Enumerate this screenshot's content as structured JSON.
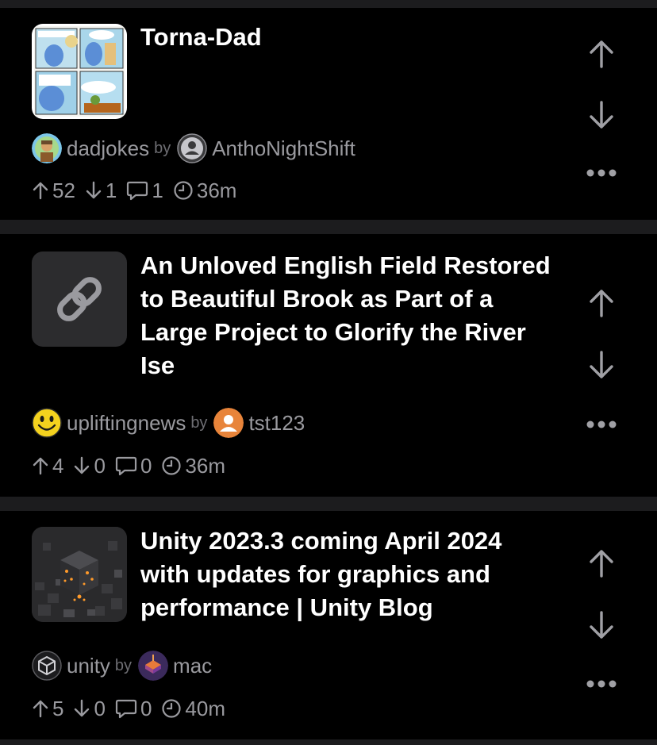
{
  "posts": [
    {
      "title": "Torna-Dad",
      "community": "dadjokes",
      "by": "by",
      "author": "AnthoNightShift",
      "upvotes": "52",
      "downvotes": "1",
      "comments": "1",
      "age": "36m",
      "thumbnail": "comic-thumbnail"
    },
    {
      "title": "An Unloved English Field Restored to Beautiful Brook as Part of a Large Project to Glorify the River Ise",
      "community": "upliftingnews",
      "by": "by",
      "author": "tst123",
      "upvotes": "4",
      "downvotes": "0",
      "comments": "0",
      "age": "36m",
      "thumbnail": "link-icon"
    },
    {
      "title": "Unity 2023.3 coming April 2024 with updates for graphics and performance | Unity Blog",
      "community": "unity",
      "by": "by",
      "author": "mac",
      "upvotes": "5",
      "downvotes": "0",
      "comments": "0",
      "age": "40m",
      "thumbnail": "cube-image-thumbnail"
    }
  ],
  "colors": {
    "background": "#000000",
    "separator": "#1c1c1e",
    "meta_text": "#9a9a9f",
    "icon": "#a0a0a5",
    "author_avatar_orange": "#e8843a",
    "smiley_yellow": "#f4d21e"
  }
}
